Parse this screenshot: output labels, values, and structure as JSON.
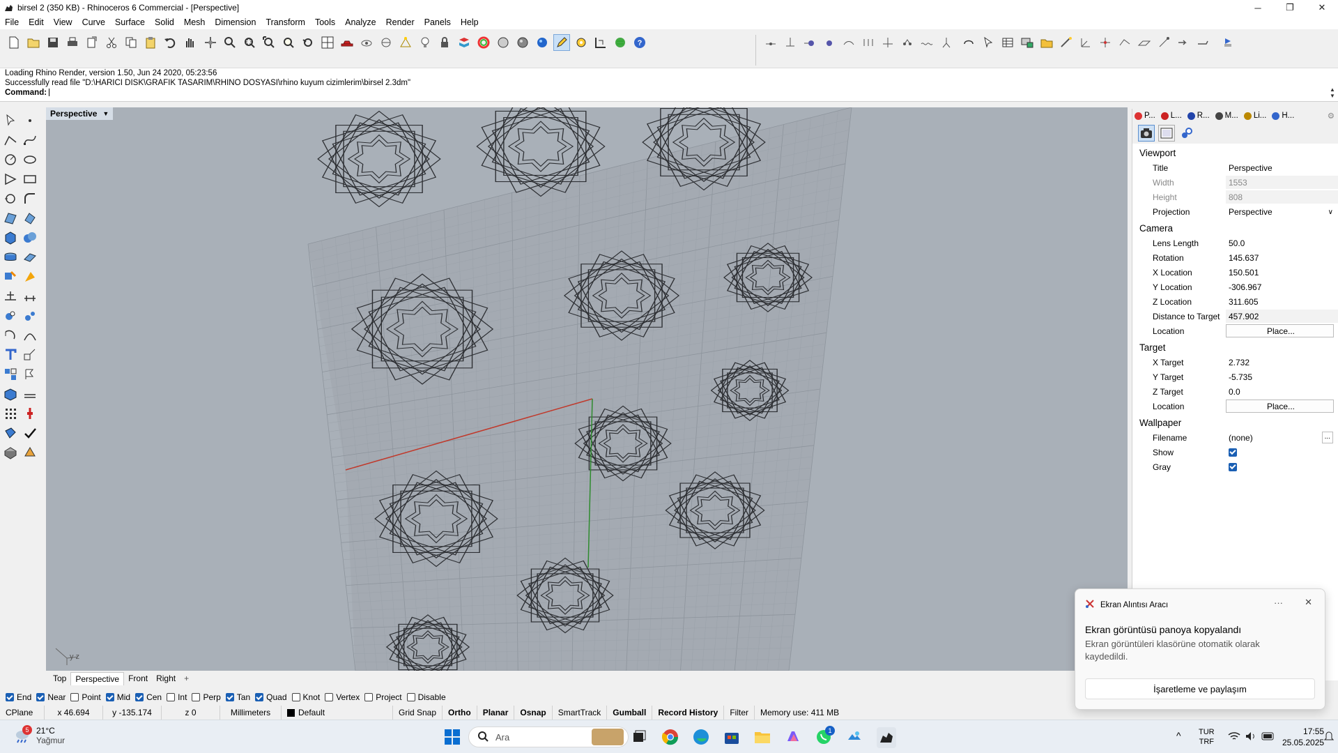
{
  "window": {
    "title": "birsel 2 (350 KB) - Rhinoceros 6 Commercial - [Perspective]",
    "minimize": "─",
    "maximize": "❐",
    "close": "✕"
  },
  "menu": [
    "File",
    "Edit",
    "View",
    "Curve",
    "Surface",
    "Solid",
    "Mesh",
    "Dimension",
    "Transform",
    "Tools",
    "Analyze",
    "Render",
    "Panels",
    "Help"
  ],
  "command": {
    "history": [
      "Loading Rhino Render, version 1.50, Jun 24 2020, 05:23:56",
      "Successfully read file \"D:\\HARICI DISK\\GRAFIK TASARIM\\RHINO DOSYASI\\rhino kuyum cizimlerim\\birsel 2.3dm\""
    ],
    "prompt": "Command:",
    "input": ""
  },
  "viewport": {
    "title": "Perspective",
    "axis_label": "y z",
    "tabs": [
      "Top",
      "Perspective",
      "Front",
      "Right"
    ],
    "active_tab": "Perspective",
    "add_tab": "+"
  },
  "osnap": [
    {
      "label": "End",
      "on": true
    },
    {
      "label": "Near",
      "on": true
    },
    {
      "label": "Point",
      "on": false
    },
    {
      "label": "Mid",
      "on": true
    },
    {
      "label": "Cen",
      "on": true
    },
    {
      "label": "Int",
      "on": false
    },
    {
      "label": "Perp",
      "on": false
    },
    {
      "label": "Tan",
      "on": true
    },
    {
      "label": "Quad",
      "on": true
    },
    {
      "label": "Knot",
      "on": false
    },
    {
      "label": "Vertex",
      "on": false
    },
    {
      "label": "Project",
      "on": false
    },
    {
      "label": "Disable",
      "on": false
    }
  ],
  "status": {
    "cplane": "CPlane",
    "x": "x 46.694",
    "y": "y -135.174",
    "z": "z 0",
    "units": "Millimeters",
    "layer": "Default",
    "toggles": [
      {
        "label": "Grid Snap",
        "bold": false
      },
      {
        "label": "Ortho",
        "bold": true
      },
      {
        "label": "Planar",
        "bold": true
      },
      {
        "label": "Osnap",
        "bold": true
      },
      {
        "label": "SmartTrack",
        "bold": false
      },
      {
        "label": "Gumball",
        "bold": true
      },
      {
        "label": "Record History",
        "bold": true
      },
      {
        "label": "Filter",
        "bold": false
      }
    ],
    "memory": "Memory use: 411 MB"
  },
  "panel": {
    "tabs": [
      "P...",
      "L...",
      "R...",
      "M...",
      "Li...",
      "H..."
    ],
    "tab_colors": [
      "#d33",
      "#c22",
      "#24a",
      "#444",
      "#b80",
      "#36c"
    ],
    "viewport_section": "Viewport",
    "viewport_rows": [
      {
        "label": "Title",
        "value": "Perspective",
        "disabled": false
      },
      {
        "label": "Width",
        "value": "1553",
        "disabled": true
      },
      {
        "label": "Height",
        "value": "808",
        "disabled": true
      },
      {
        "label": "Projection",
        "value": "Perspective",
        "disabled": false,
        "dropdown": true
      }
    ],
    "camera_section": "Camera",
    "camera_rows": [
      {
        "label": "Lens Length",
        "value": "50.0"
      },
      {
        "label": "Rotation",
        "value": "145.637"
      },
      {
        "label": "X Location",
        "value": "150.501"
      },
      {
        "label": "Y Location",
        "value": "-306.967"
      },
      {
        "label": "Z Location",
        "value": "311.605"
      },
      {
        "label": "Distance to Target",
        "value": "457.902"
      }
    ],
    "camera_location_label": "Location",
    "place_button": "Place...",
    "target_section": "Target",
    "target_rows": [
      {
        "label": "X Target",
        "value": "2.732"
      },
      {
        "label": "Y Target",
        "value": "-5.735"
      },
      {
        "label": "Z Target",
        "value": "0.0"
      }
    ],
    "target_location_label": "Location",
    "wallpaper_section": "Wallpaper",
    "filename_label": "Filename",
    "filename_value": "(none)",
    "filename_button": "...",
    "show_label": "Show",
    "gray_label": "Gray"
  },
  "toast": {
    "app": "Ekran Alıntısı Aracı",
    "more": "···",
    "close": "✕",
    "title": "Ekran görüntüsü panoya kopyalandı",
    "body": "Ekran görüntüleri klasörüne otomatik olarak kaydedildi.",
    "button": "İşaretleme ve paylaşım"
  },
  "taskbar": {
    "weather_temp": "21°C",
    "weather_desc": "Yağmur",
    "weather_badge": "5",
    "search": "Ara",
    "whatsapp_badge": "1",
    "lang1": "TUR",
    "lang2": "TRF",
    "time": "17:55",
    "date": "25.05.2025"
  }
}
